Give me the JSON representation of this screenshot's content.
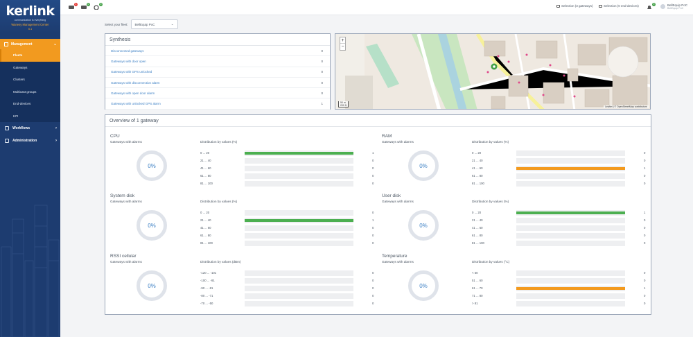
{
  "sidebar": {
    "logo_text": "kerlink",
    "logo_tagline": "communication is everything",
    "app_name": "Wanesy Management Center",
    "version": "5.1",
    "section": "Management",
    "items": [
      {
        "label": "Fleets",
        "active": true
      },
      {
        "label": "Gateways",
        "active": false
      },
      {
        "label": "Clusters",
        "active": false
      },
      {
        "label": "Multicast groups",
        "active": false
      },
      {
        "label": "End-devices",
        "active": false
      },
      {
        "label": "KPI",
        "active": false
      }
    ],
    "workflows": "Workflows",
    "administration": "Administration"
  },
  "topbar": {
    "badge_alerts": "1",
    "badge_messages": "0",
    "badge_settings": "0",
    "badge_notifications": "0",
    "selection_gateways": "Selection (3 gateways)",
    "selection_devices": "Selection (0 end-devices)",
    "user_name": "BellEquip PoC",
    "user_role": "BellEquip PoC"
  },
  "fleet": {
    "label": "Select your fleet:",
    "value": "BellEquip PoC"
  },
  "synthesis": {
    "title": "Synthesis",
    "rows": [
      {
        "label": "Disconnected gateways",
        "value": "0"
      },
      {
        "label": "Gateways with door open",
        "value": "0"
      },
      {
        "label": "Gateways with GPS unlocked",
        "value": "0"
      },
      {
        "label": "Gateways with disconnection alarm",
        "value": "0"
      },
      {
        "label": "Gateways with open door alarm",
        "value": "0"
      },
      {
        "label": "Gateways with unlocked GPS alarm",
        "value": "1"
      }
    ]
  },
  "map": {
    "zoom_in": "+",
    "zoom_out": "−",
    "scale_m": "50 m",
    "scale_ft": "200 ft",
    "attribution": "Leaflet | © OpenStreetMap contributors"
  },
  "overview": {
    "title": "Overview of 1 gateway",
    "alarms_label": "Gateways with alarms",
    "metrics": [
      {
        "name": "CPU",
        "donut": "0%",
        "dist_label": "Distribution by values (%)",
        "color": "#4caf50",
        "rows": [
          {
            "range": "0 ... 20",
            "value": "1",
            "fill": 1
          },
          {
            "range": "21 ... 40",
            "value": "0",
            "fill": 0
          },
          {
            "range": "41 ... 60",
            "value": "0",
            "fill": 0
          },
          {
            "range": "61 ... 80",
            "value": "0",
            "fill": 0
          },
          {
            "range": "81 ... 100",
            "value": "0",
            "fill": 0
          }
        ]
      },
      {
        "name": "RAM",
        "donut": "0%",
        "dist_label": "Distribution by values (%)",
        "color": "#f39a1e",
        "rows": [
          {
            "range": "0 ... 20",
            "value": "0",
            "fill": 0
          },
          {
            "range": "21 ... 40",
            "value": "0",
            "fill": 0
          },
          {
            "range": "41 ... 60",
            "value": "1",
            "fill": 1
          },
          {
            "range": "61 ... 80",
            "value": "0",
            "fill": 0
          },
          {
            "range": "81 ... 100",
            "value": "0",
            "fill": 0
          }
        ]
      },
      {
        "name": "System disk",
        "donut": "0%",
        "dist_label": "Distribution by values (%)",
        "color": "#4caf50",
        "rows": [
          {
            "range": "0 ... 20",
            "value": "0",
            "fill": 0
          },
          {
            "range": "21 ... 40",
            "value": "1",
            "fill": 1
          },
          {
            "range": "41 ... 60",
            "value": "0",
            "fill": 0
          },
          {
            "range": "61 ... 80",
            "value": "0",
            "fill": 0
          },
          {
            "range": "81 ... 100",
            "value": "0",
            "fill": 0
          }
        ]
      },
      {
        "name": "User disk",
        "donut": "0%",
        "dist_label": "Distribution by values (%)",
        "color": "#4caf50",
        "rows": [
          {
            "range": "0 ... 20",
            "value": "1",
            "fill": 1
          },
          {
            "range": "21 ... 40",
            "value": "0",
            "fill": 0
          },
          {
            "range": "41 ... 60",
            "value": "0",
            "fill": 0
          },
          {
            "range": "61 ... 80",
            "value": "0",
            "fill": 0
          },
          {
            "range": "81 ... 100",
            "value": "0",
            "fill": 0
          }
        ]
      },
      {
        "name": "RSSI cellular",
        "donut": "0%",
        "dist_label": "Distribution by values (dBm)",
        "color": "#4caf50",
        "rows": [
          {
            "range": "-120 ... -101",
            "value": "0",
            "fill": 0
          },
          {
            "range": "-100 ... -91",
            "value": "0",
            "fill": 0
          },
          {
            "range": "-90 ... -81",
            "value": "0",
            "fill": 0
          },
          {
            "range": "-80 ... -71",
            "value": "0",
            "fill": 0
          },
          {
            "range": "-70 ... -50",
            "value": "0",
            "fill": 0
          }
        ]
      },
      {
        "name": "Temperature",
        "donut": "0%",
        "dist_label": "Distribution by values (°C)",
        "color": "#f39a1e",
        "rows": [
          {
            "range": "< 50",
            "value": "0",
            "fill": 0
          },
          {
            "range": "51 ... 60",
            "value": "0",
            "fill": 0
          },
          {
            "range": "61 ... 70",
            "value": "1",
            "fill": 1
          },
          {
            "range": "71 ... 80",
            "value": "0",
            "fill": 0
          },
          {
            "range": "> 81",
            "value": "0",
            "fill": 0
          }
        ]
      }
    ]
  }
}
